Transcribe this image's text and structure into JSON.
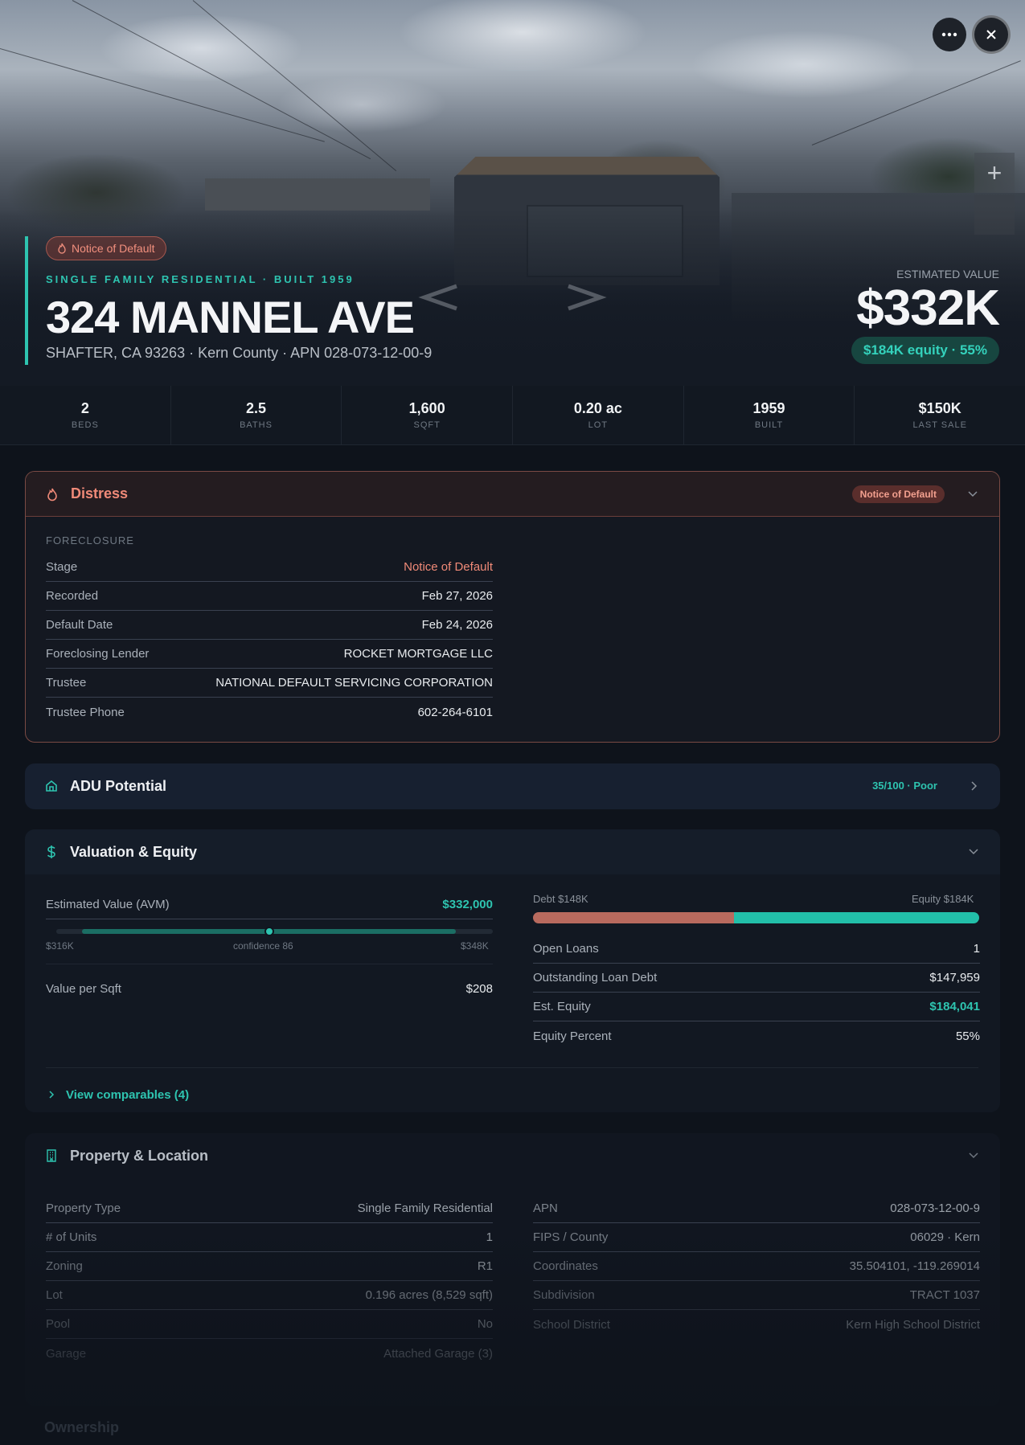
{
  "hero": {
    "badge": "Notice of Default",
    "subtitle": "SINGLE FAMILY RESIDENTIAL · BUILT 1959",
    "title": "324 MANNEL AVE",
    "address": "SHAFTER, CA 93263 · Kern County · APN 028-073-12-00-9",
    "est_label": "ESTIMATED VALUE",
    "est_value": "$332K",
    "equity_pill": "$184K equity · 55%"
  },
  "stats": [
    {
      "value": "2",
      "label": "BEDS"
    },
    {
      "value": "2.5",
      "label": "BATHS"
    },
    {
      "value": "1,600",
      "label": "SQFT"
    },
    {
      "value": "0.20 ac",
      "label": "LOT"
    },
    {
      "value": "1959",
      "label": "BUILT"
    },
    {
      "value": "$150K",
      "label": "LAST SALE"
    }
  ],
  "distress": {
    "title": "Distress",
    "tag": "Notice of Default",
    "section": "FORECLOSURE",
    "rows": [
      {
        "k": "Stage",
        "v": "Notice of Default"
      },
      {
        "k": "Recorded",
        "v": "Feb 27, 2026"
      },
      {
        "k": "Default Date",
        "v": "Feb 24, 2026"
      },
      {
        "k": "Foreclosing Lender",
        "v": "ROCKET MORTGAGE LLC"
      },
      {
        "k": "Trustee",
        "v": "NATIONAL DEFAULT SERVICING CORPORATION"
      },
      {
        "k": "Trustee Phone",
        "v": "602-264-6101"
      }
    ]
  },
  "adu": {
    "title": "ADU Potential",
    "score": "35/100 · Poor"
  },
  "valuation": {
    "title": "Valuation & Equity",
    "avm_label": "Estimated Value (AVM)",
    "avm_value": "$332,000",
    "range_low": "$316K",
    "range_high": "$348K",
    "confidence_label": "confidence 86",
    "avm_range_fraction": 0.5,
    "sqft_label": "Value per Sqft",
    "sqft_value": "$208",
    "debt_label": "Debt $148K",
    "equity_label": "Equity $184K",
    "debt_fraction": 0.45,
    "rows": [
      {
        "k": "Open Loans",
        "v": "1"
      },
      {
        "k": "Outstanding Loan Debt",
        "v": "$147,959"
      },
      {
        "k": "Est. Equity",
        "v": "$184,041"
      },
      {
        "k": "Equity Percent",
        "v": "55%"
      }
    ],
    "comparables_link": "View comparables (4)"
  },
  "property": {
    "title": "Property & Location",
    "left": [
      {
        "k": "Property Type",
        "v": "Single Family Residential"
      },
      {
        "k": "# of Units",
        "v": "1"
      },
      {
        "k": "Zoning",
        "v": "R1"
      },
      {
        "k": "Lot",
        "v": "0.196 acres (8,529 sqft)"
      },
      {
        "k": "Pool",
        "v": "No"
      },
      {
        "k": "Garage",
        "v": "Attached Garage (3)"
      }
    ],
    "right": [
      {
        "k": "APN",
        "v": "028-073-12-00-9"
      },
      {
        "k": "FIPS / County",
        "v": "06029 · Kern"
      },
      {
        "k": "Coordinates",
        "v": "35.504101, -119.269014"
      },
      {
        "k": "Subdivision",
        "v": "TRACT 1037"
      },
      {
        "k": "School District",
        "v": "Kern High School District"
      }
    ]
  },
  "ownership": {
    "title": "Ownership"
  },
  "colors": {
    "accent": "#2ec4b0",
    "distress": "#f08a78",
    "debt": "#b86a5e"
  }
}
